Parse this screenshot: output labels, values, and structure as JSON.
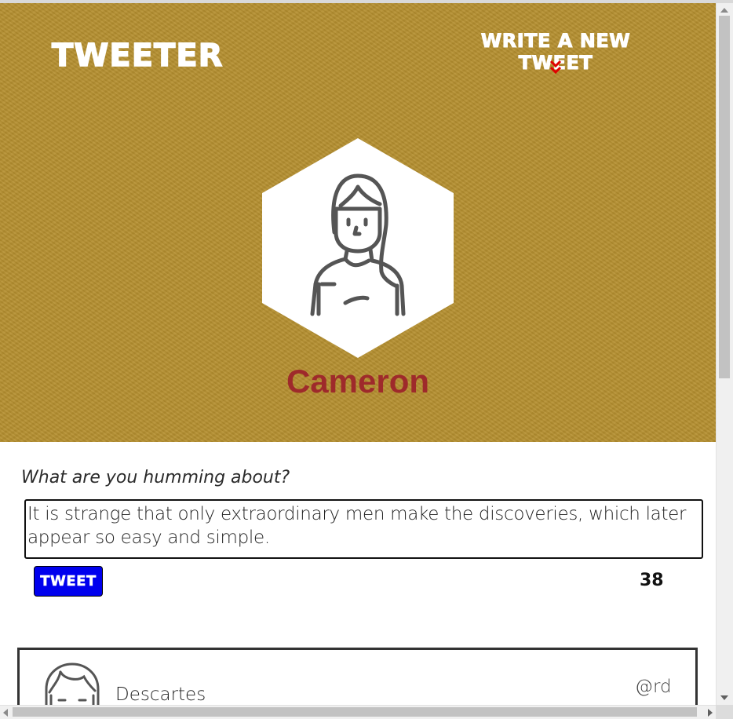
{
  "nav": {
    "logo": "TWEETER",
    "compose_link": "WRITE A NEW TWEET",
    "compose_icon": "double-chevron-down-icon"
  },
  "profile": {
    "name": "Cameron",
    "avatar_icon": "woman-avatar-icon"
  },
  "composer": {
    "prompt": "What are you humming about?",
    "text": "It is strange that only extraordinary men make the discoveries, which later appear so easy and simple.",
    "submit_label": "TWEET",
    "char_counter": "38"
  },
  "tweets": [
    {
      "author": "Descartes",
      "handle": "@rd",
      "avatar_icon": "girl-avatar-icon"
    }
  ],
  "colors": {
    "header_bg": "#b58f2f",
    "username": "#9e2a2b",
    "tweet_button": "#0000ee",
    "chevron": "#e00000"
  }
}
